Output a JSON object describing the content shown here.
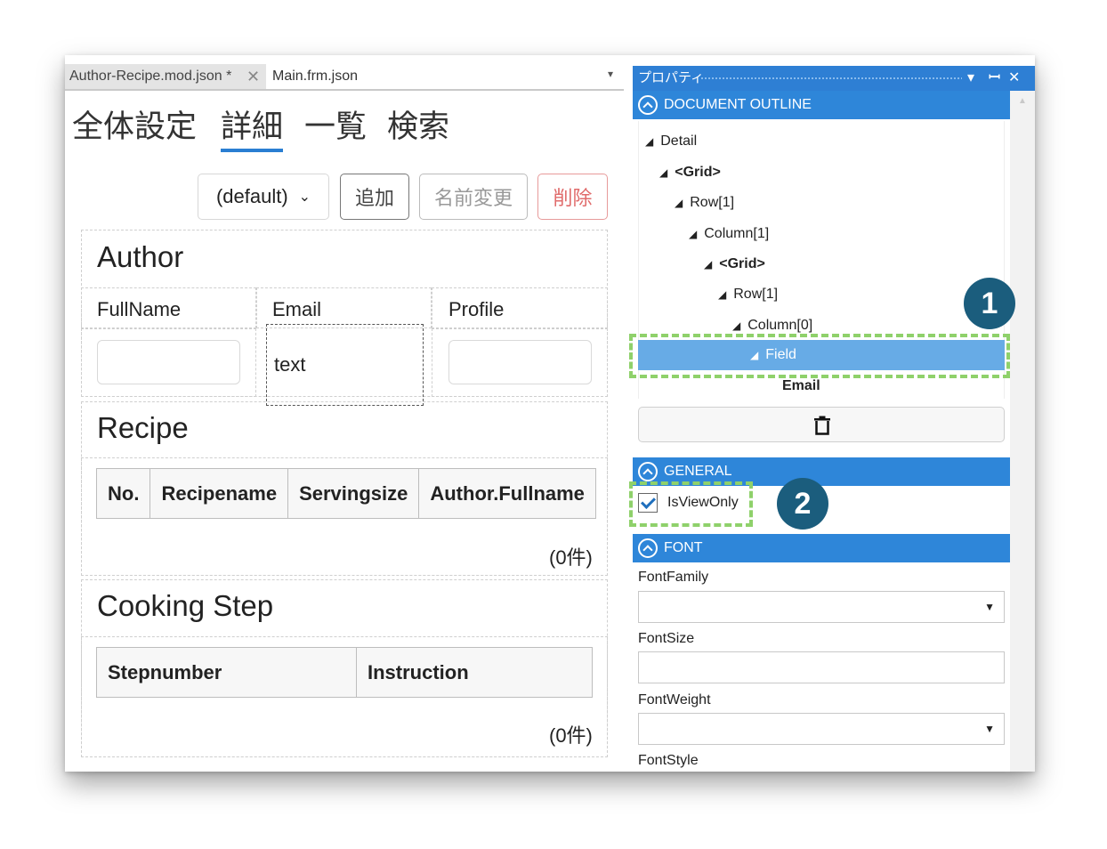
{
  "editor": {
    "tabs": [
      {
        "label": "Author-Recipe.mod.json *"
      },
      {
        "label": "Main.frm.json"
      }
    ],
    "view_tabs": [
      {
        "label": "全体設定"
      },
      {
        "label": "詳細"
      },
      {
        "label": "一覧"
      },
      {
        "label": "検索"
      }
    ],
    "toolbar": {
      "select_value": "(default)",
      "add_label": "追加",
      "rename_label": "名前変更",
      "delete_label": "削除"
    },
    "author": {
      "title": "Author",
      "columns": [
        "FullName",
        "Email",
        "Profile"
      ],
      "email_value": "text"
    },
    "recipe": {
      "title": "Recipe",
      "columns": [
        "No.",
        "Recipename",
        "Servingsize",
        "Author.Fullname"
      ],
      "count": "(0件)"
    },
    "cooking": {
      "title": "Cooking Step",
      "columns": [
        "Stepnumber",
        "Instruction"
      ],
      "count": "(0件)"
    }
  },
  "properties": {
    "title": "プロパティ",
    "outline_header": "DOCUMENT OUTLINE",
    "tree": [
      {
        "label": "Detail",
        "bold": false
      },
      {
        "label": "<Grid>",
        "bold": true
      },
      {
        "label": "Row[1]",
        "bold": false
      },
      {
        "label": "Column[1]",
        "bold": false
      },
      {
        "label": "<Grid>",
        "bold": true
      },
      {
        "label": "Row[1]",
        "bold": false
      },
      {
        "label": "Column[0]",
        "bold": false
      }
    ],
    "selected_item": "Field",
    "selected_sub": "Email",
    "general_header": "GENERAL",
    "isviewonly_label": "IsViewOnly",
    "isviewonly_checked": true,
    "font_header": "FONT",
    "font_fields": {
      "family": "FontFamily",
      "size": "FontSize",
      "weight": "FontWeight",
      "style": "FontStyle"
    }
  },
  "annotations": {
    "badge1": "1",
    "badge2": "2",
    "callout_color": "#8fd16b",
    "badge_color": "#1b5d7d"
  },
  "colors": {
    "accent": "#2e86d9",
    "selection": "#67abe6",
    "delete": "#e06b6b"
  }
}
